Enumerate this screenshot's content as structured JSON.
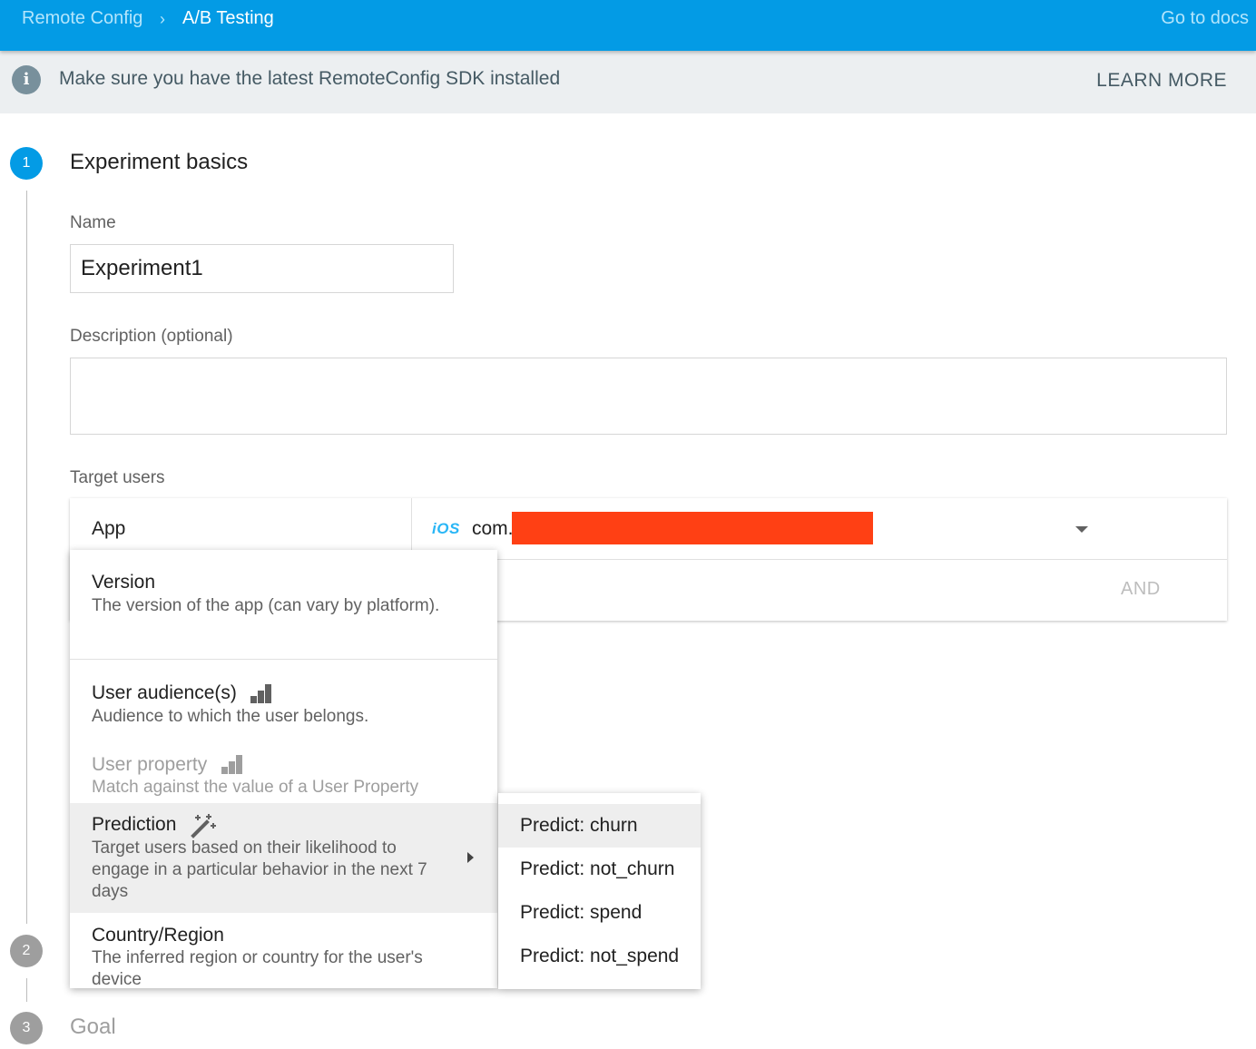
{
  "header": {
    "breadcrumb": [
      "Remote Config",
      "A/B Testing"
    ],
    "breadcrumb_separator": "›",
    "docs_link": "Go to docs",
    "bar_color": "#039be5"
  },
  "banner": {
    "icon": "info-icon",
    "icon_glyph": "i",
    "message": "Make sure you have the latest RemoteConfig SDK installed",
    "action": "LEARN MORE"
  },
  "steps": [
    {
      "number": "1",
      "title": "Experiment basics",
      "state": "active"
    },
    {
      "number": "2",
      "title": "",
      "state": "inactive"
    },
    {
      "number": "3",
      "title": "Goal",
      "state": "inactive"
    }
  ],
  "form": {
    "name_label": "Name",
    "name_value": "Experiment1",
    "description_label": "Description (optional)",
    "description_value": "",
    "target_label": "Target users"
  },
  "target": {
    "app_label": "App",
    "platform_badge": "iOS",
    "app_value_visible": "com.",
    "redaction_color": "#ff4014",
    "and_button": "AND"
  },
  "menu": {
    "items": [
      {
        "title": "Version",
        "description": "The version of the app (can vary by platform).",
        "disabled": false
      },
      {
        "title": "User audience(s)",
        "description": "Audience to which the user belongs.",
        "icon": "analytics-bars-icon",
        "disabled": false
      },
      {
        "title": "User property",
        "description": "Match against the value of a User Property",
        "icon": "analytics-bars-icon",
        "disabled": true
      },
      {
        "title": "Prediction",
        "description": "Target users based on their likelihood to engage in a particular behavior in the next 7 days",
        "icon": "magic-wand-icon",
        "highlighted": true,
        "has_submenu": true
      },
      {
        "title": "Country/Region",
        "description": "The inferred region or country for the user's device",
        "disabled": false
      }
    ]
  },
  "submenu": {
    "items": [
      "Predict: churn",
      "Predict: not_churn",
      "Predict: spend",
      "Predict: not_spend"
    ],
    "highlighted_index": 0
  }
}
